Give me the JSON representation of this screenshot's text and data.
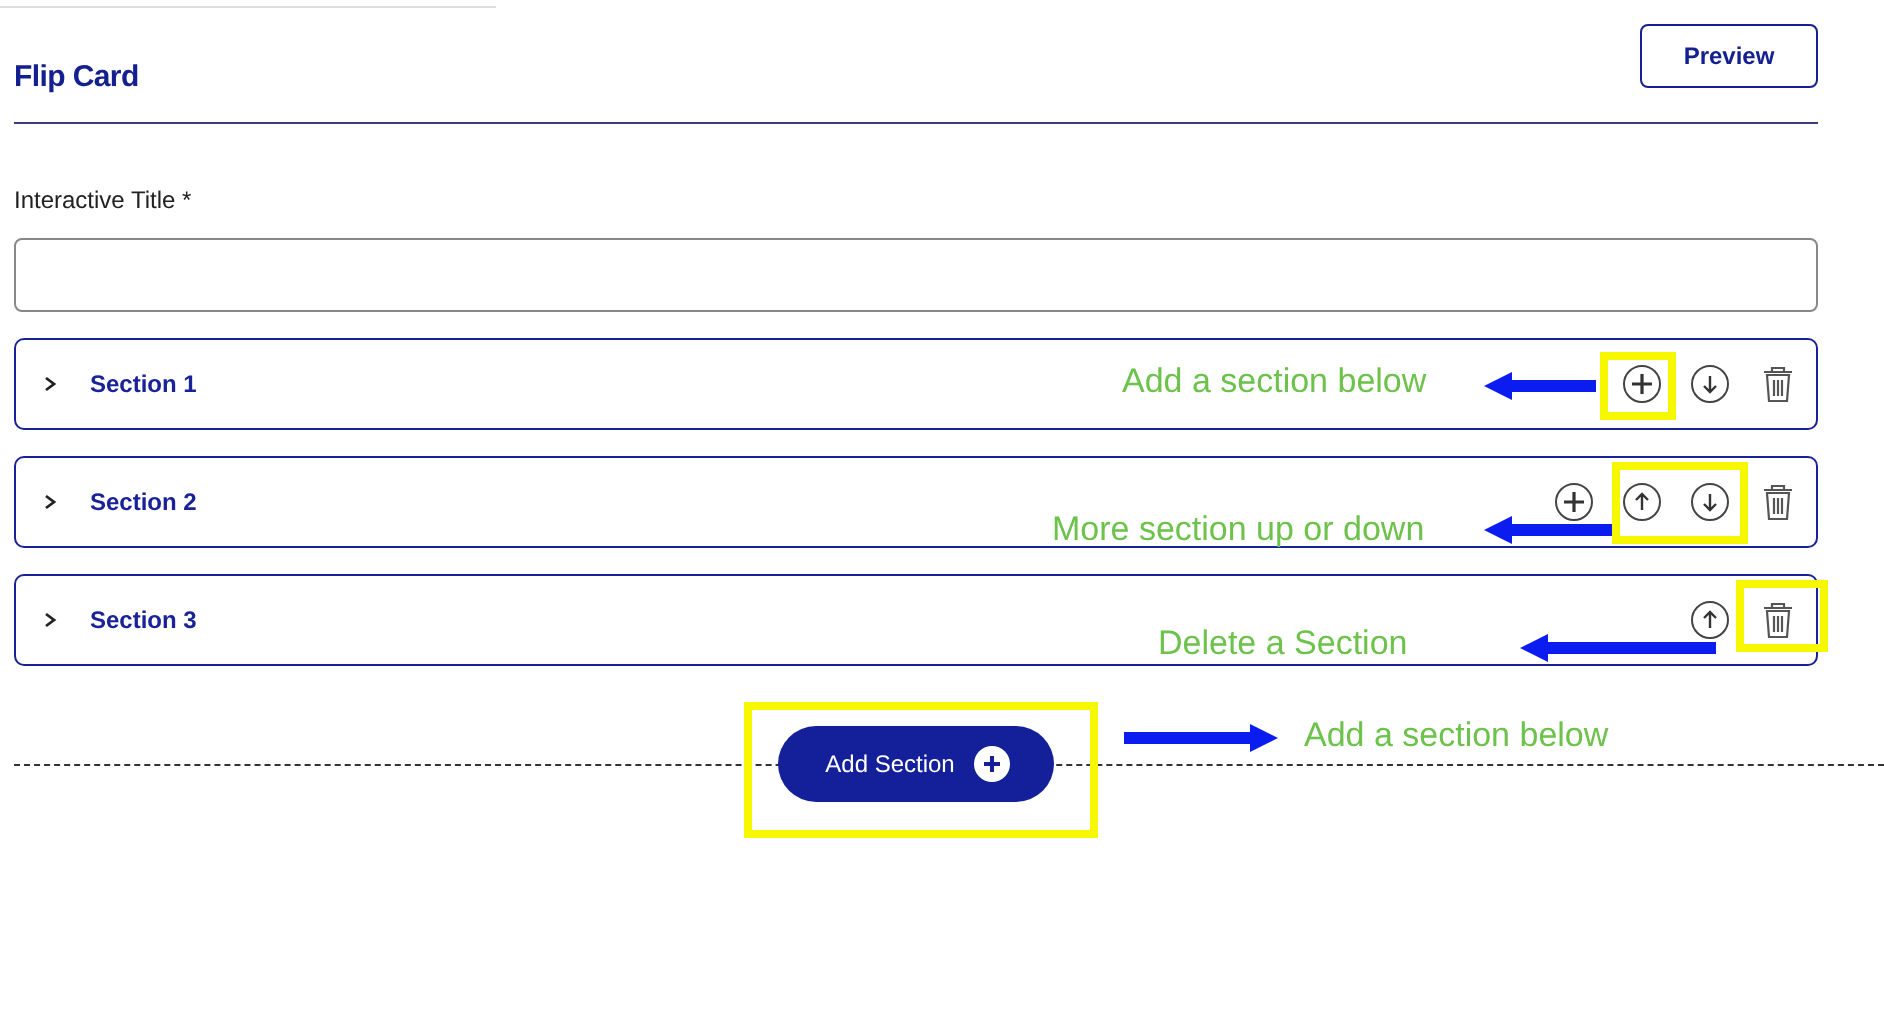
{
  "header": {
    "title": "Flip Card",
    "preview_button": "Preview"
  },
  "title_field": {
    "label": "Interactive Title",
    "required_mark": "*"
  },
  "sections": [
    {
      "title": "Section 1",
      "expanded": false,
      "actions": [
        {
          "kind": "add"
        },
        {
          "kind": "down"
        },
        {
          "kind": "delete"
        }
      ]
    },
    {
      "title": "Section 2",
      "expanded": false,
      "actions": [
        {
          "kind": "add"
        },
        {
          "kind": "up"
        },
        {
          "kind": "down"
        },
        {
          "kind": "delete"
        }
      ]
    },
    {
      "title": "Section 3",
      "expanded": false,
      "actions": [
        {
          "kind": "up"
        },
        {
          "kind": "delete"
        }
      ]
    }
  ],
  "add_section_button": "Add Section",
  "annotations": [
    {
      "text": "Add a section below",
      "kind": "left"
    },
    {
      "text": "More section up or down",
      "kind": "left"
    },
    {
      "text": "Delete a Section",
      "kind": "left"
    },
    {
      "text": "Add a section below",
      "kind": "right"
    }
  ]
}
